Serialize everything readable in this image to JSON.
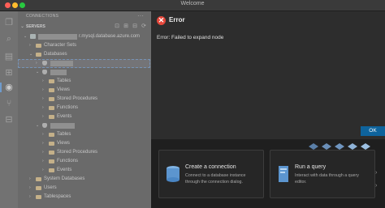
{
  "window": {
    "title": "Welcome"
  },
  "sidebar": {
    "header": "CONNECTIONS",
    "more": "···",
    "servers_label": "SERVERS",
    "server_name": "r.mysql.database.azure.com",
    "rows": [
      {
        "label": "Character Sets",
        "indent": 14,
        "kind": "folder",
        "caret": "›"
      },
      {
        "label": "Databases",
        "indent": 14,
        "kind": "folder",
        "caret": "⌄"
      },
      {
        "label": "",
        "indent": 22,
        "kind": "db",
        "caret": "›",
        "redact_w": 28,
        "selected": true
      },
      {
        "label": "",
        "indent": 22,
        "kind": "db",
        "caret": "⌄",
        "redact_w": 20
      },
      {
        "label": "Tables",
        "indent": 30,
        "kind": "folder",
        "caret": "›"
      },
      {
        "label": "Views",
        "indent": 30,
        "kind": "folder",
        "caret": "›"
      },
      {
        "label": "Stored Procedures",
        "indent": 30,
        "kind": "folder",
        "caret": "›"
      },
      {
        "label": "Functions",
        "indent": 30,
        "kind": "folder",
        "caret": "›"
      },
      {
        "label": "Events",
        "indent": 30,
        "kind": "folder",
        "caret": "›"
      },
      {
        "label": "",
        "indent": 22,
        "kind": "db",
        "caret": "⌄",
        "redact_w": 30
      },
      {
        "label": "Tables",
        "indent": 30,
        "kind": "folder",
        "caret": "›"
      },
      {
        "label": "Views",
        "indent": 30,
        "kind": "folder",
        "caret": "›"
      },
      {
        "label": "Stored Procedures",
        "indent": 30,
        "kind": "folder",
        "caret": "›"
      },
      {
        "label": "Functions",
        "indent": 30,
        "kind": "folder",
        "caret": "›"
      },
      {
        "label": "Events",
        "indent": 30,
        "kind": "folder",
        "caret": "›"
      },
      {
        "label": "System Databases",
        "indent": 14,
        "kind": "folder",
        "caret": "›"
      },
      {
        "label": "Users",
        "indent": 14,
        "kind": "folder",
        "caret": "›"
      },
      {
        "label": "Tablespaces",
        "indent": 14,
        "kind": "folder",
        "caret": "›"
      }
    ]
  },
  "dialog": {
    "title": "Error",
    "icon": "error-icon",
    "message": "Error: Failed to expand node",
    "ok_label": "OK"
  },
  "welcome": {
    "cards": [
      {
        "title": "Create a connection",
        "desc": "Connect to a database instance through the connection dialog."
      },
      {
        "title": "Run a query",
        "desc": "Interact with data through a query editor."
      }
    ]
  },
  "colors": {
    "accent": "#0e639c",
    "error": "#e5473b"
  }
}
